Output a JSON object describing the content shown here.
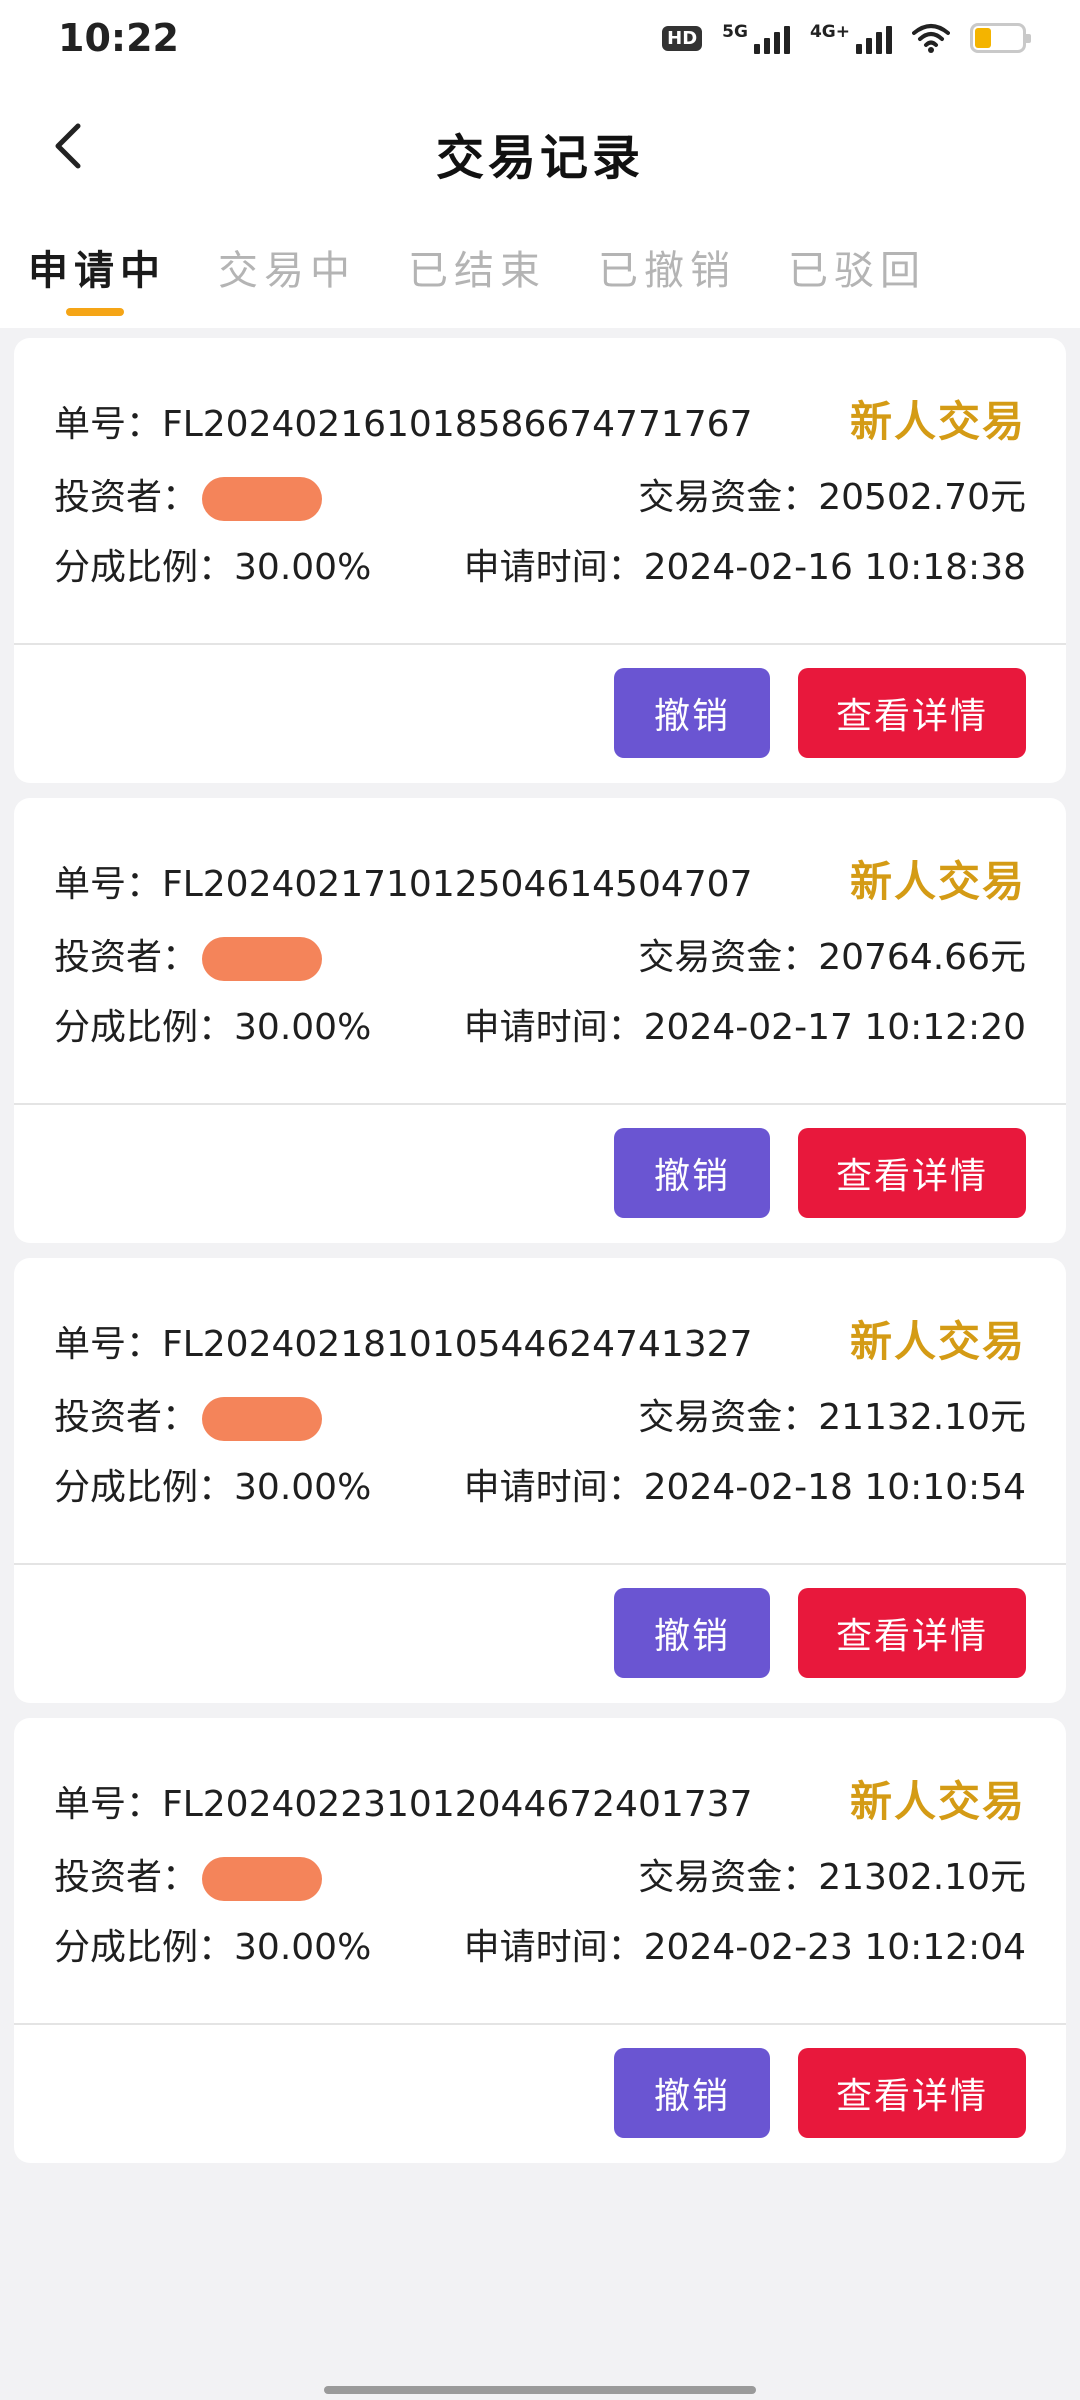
{
  "status_bar": {
    "time": "10:22",
    "hd_label": "HD",
    "net1_label": "5G",
    "net2_label": "4G+",
    "icons": [
      "hd-icon",
      "signal-5g-icon",
      "signal-4g-icon",
      "wifi-icon",
      "battery-icon"
    ],
    "battery_color": "#f4b400"
  },
  "header": {
    "title": "交易记录",
    "back_icon": "chevron-left-icon"
  },
  "tabs": [
    {
      "label": "申请中",
      "active": true
    },
    {
      "label": "交易中",
      "active": false
    },
    {
      "label": "已结束",
      "active": false
    },
    {
      "label": "已撤销",
      "active": false
    },
    {
      "label": "已驳回",
      "active": false
    }
  ],
  "labels": {
    "order_prefix": "单号：",
    "investor": "投资者：",
    "funds": "交易资金：",
    "ratio": "分成比例：",
    "apply_time": "申请时间：",
    "cancel_button": "撤销",
    "detail_button": "查看详情"
  },
  "records": [
    {
      "order_no": "FL20240216101858667477​1767",
      "tag": "新人交易",
      "funds": "20502.70元",
      "ratio": "30.00%",
      "apply_time": "2024-02-16 10:18:38"
    },
    {
      "order_no": "FL202402171012504614504707",
      "tag": "新人交易",
      "funds": "20764.66元",
      "ratio": "30.00%",
      "apply_time": "2024-02-17 10:12:20"
    },
    {
      "order_no": "FL202402181010544624741327",
      "tag": "新人交易",
      "funds": "21132.10元",
      "ratio": "30.00%",
      "apply_time": "2024-02-18 10:10:54"
    },
    {
      "order_no": "FL202402231012044672401737",
      "tag": "新人交易",
      "funds": "21302.10元",
      "ratio": "30.00%",
      "apply_time": "2024-02-23 10:12:04"
    }
  ],
  "colors": {
    "accent_tab": "#f5a516",
    "tag_new": "#d49b15",
    "cancel_button": "#6a55d2",
    "detail_button": "#e8183c",
    "redaction": "#f4845a"
  }
}
